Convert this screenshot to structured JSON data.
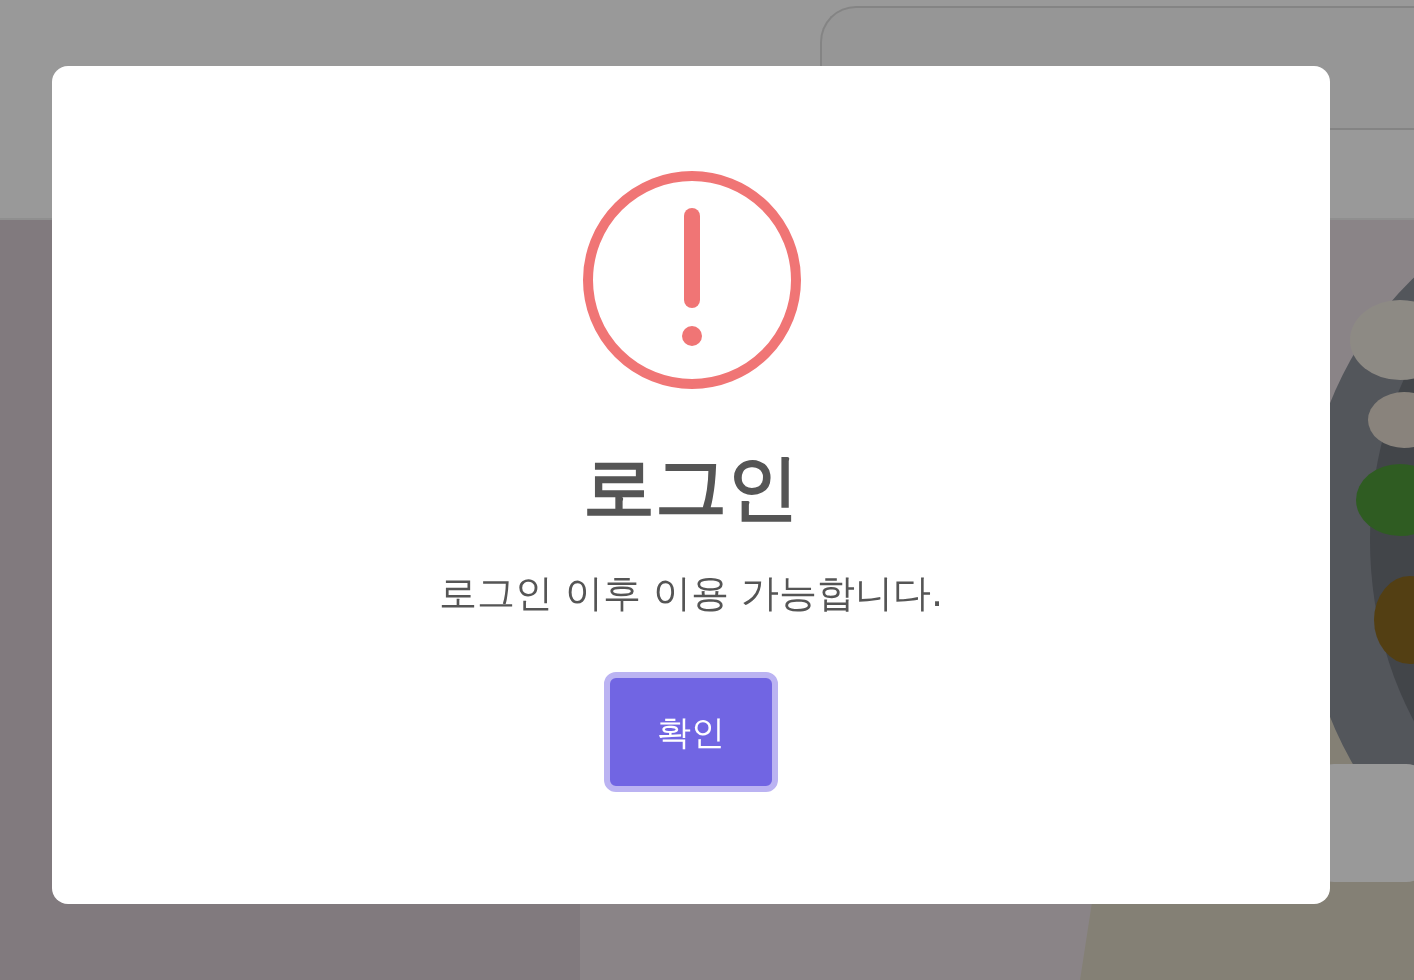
{
  "dialog": {
    "title": "로그인",
    "message": "로그인 이후 이용 가능합니다.",
    "buttons": [
      {
        "label": "확인",
        "selected": true
      }
    ]
  }
}
